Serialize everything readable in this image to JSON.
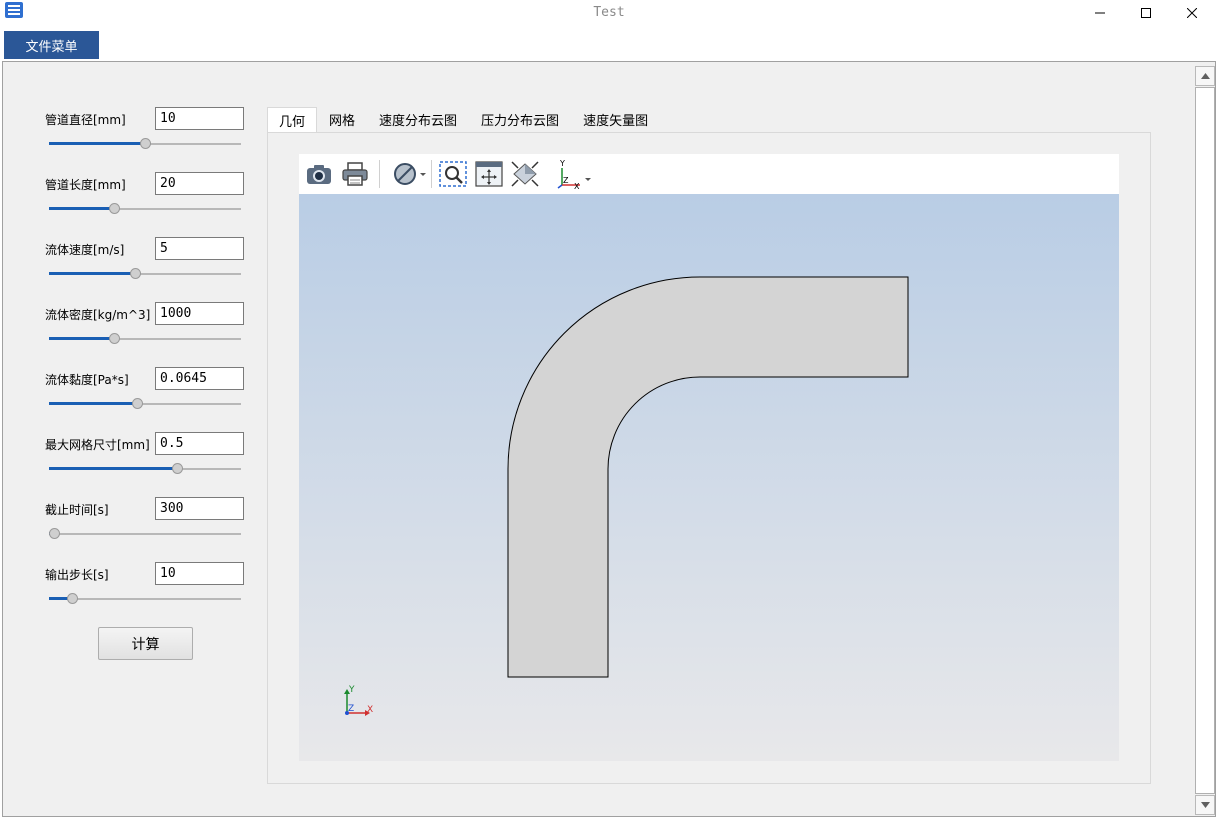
{
  "window": {
    "title": "Test"
  },
  "menu": {
    "file_label": "文件菜单"
  },
  "params": [
    {
      "label": "管道直径[mm]",
      "value": "10",
      "slider": 0.5
    },
    {
      "label": "管道长度[mm]",
      "value": "20",
      "slider": 0.33
    },
    {
      "label": "流体速度[m/s]",
      "value": "5",
      "slider": 0.45
    },
    {
      "label": "流体密度[kg/m^3]",
      "value": "1000",
      "slider": 0.33
    },
    {
      "label": "流体黏度[Pa*s]",
      "value": "0.0645",
      "slider": 0.46
    },
    {
      "label": "最大网格尺寸[mm]",
      "value": "0.5",
      "slider": 0.68
    },
    {
      "label": "截止时间[s]",
      "value": "300",
      "slider": 0.0
    },
    {
      "label": "输出步长[s]",
      "value": "10",
      "slider": 0.1
    }
  ],
  "calc_label": "计算",
  "tabs": [
    {
      "label": "几何",
      "active": true
    },
    {
      "label": "网格",
      "active": false
    },
    {
      "label": "速度分布云图",
      "active": false
    },
    {
      "label": "压力分布云图",
      "active": false
    },
    {
      "label": "速度矢量图",
      "active": false
    }
  ],
  "toolbar": {
    "icons": [
      "camera-icon",
      "printer-icon",
      "clipping-icon",
      "zoom-box-icon",
      "fit-all-icon",
      "view-reset-icon",
      "axes-view-icon"
    ]
  },
  "axes": {
    "x": "X",
    "y": "Y",
    "z": "Z"
  },
  "colors": {
    "accent": "#2b5797",
    "slider_fill": "#1a5fb4",
    "pipe_fill": "#d4d4d4"
  }
}
